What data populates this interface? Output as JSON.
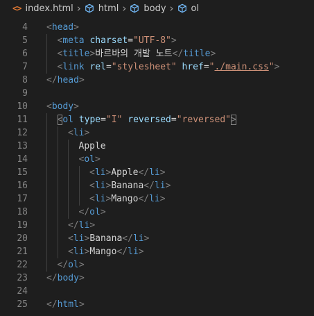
{
  "breadcrumb": {
    "file_icon": "<>",
    "file": "index.html",
    "items": [
      "html",
      "body",
      "ol"
    ]
  },
  "icons": {
    "file": "html-file-icon",
    "element": "cube-icon",
    "separator": "chevron-right-icon"
  },
  "colors": {
    "background": "#1e1e1e",
    "tag": "#569cd6",
    "bracket": "#808080",
    "attribute": "#9cdcfe",
    "string": "#ce9178",
    "text": "#d4d4d4",
    "line_number": "#858585",
    "file_icon": "#e37933"
  },
  "lines": [
    {
      "n": "4",
      "indent": 0,
      "tokens": [
        [
          "br",
          "<"
        ],
        [
          "tag",
          "head"
        ],
        [
          "br",
          ">"
        ]
      ]
    },
    {
      "n": "5",
      "indent": 1,
      "tokens": [
        [
          "br",
          "<"
        ],
        [
          "tag",
          "meta"
        ],
        [
          "pl",
          " "
        ],
        [
          "attr",
          "charset"
        ],
        [
          "pl",
          "="
        ],
        [
          "str",
          "\"UTF-8\""
        ],
        [
          "br",
          ">"
        ]
      ]
    },
    {
      "n": "6",
      "indent": 1,
      "tokens": [
        [
          "br",
          "<"
        ],
        [
          "tag",
          "title"
        ],
        [
          "br",
          ">"
        ],
        [
          "pl",
          "바르바의 개발 노트"
        ],
        [
          "br",
          "</"
        ],
        [
          "tag",
          "title"
        ],
        [
          "br",
          ">"
        ]
      ]
    },
    {
      "n": "7",
      "indent": 1,
      "tokens": [
        [
          "br",
          "<"
        ],
        [
          "tag",
          "link"
        ],
        [
          "pl",
          " "
        ],
        [
          "attr",
          "rel"
        ],
        [
          "pl",
          "="
        ],
        [
          "str",
          "\"stylesheet\""
        ],
        [
          "pl",
          " "
        ],
        [
          "attr",
          "href"
        ],
        [
          "pl",
          "="
        ],
        [
          "str",
          "\""
        ],
        [
          "str link",
          "./main.css"
        ],
        [
          "str",
          "\""
        ],
        [
          "br",
          ">"
        ]
      ]
    },
    {
      "n": "8",
      "indent": 0,
      "tokens": [
        [
          "br",
          "</"
        ],
        [
          "tag",
          "head"
        ],
        [
          "br",
          ">"
        ]
      ]
    },
    {
      "n": "9",
      "indent": 0,
      "tokens": []
    },
    {
      "n": "10",
      "indent": 0,
      "tokens": [
        [
          "br",
          "<"
        ],
        [
          "tag",
          "body"
        ],
        [
          "br",
          ">"
        ]
      ]
    },
    {
      "n": "11",
      "indent": 1,
      "tokens": [
        [
          "br hl-bracket",
          "<"
        ],
        [
          "tag",
          "ol"
        ],
        [
          "pl",
          " "
        ],
        [
          "attr",
          "type"
        ],
        [
          "pl",
          "="
        ],
        [
          "str",
          "\"I\""
        ],
        [
          "pl",
          " "
        ],
        [
          "attr",
          "reversed"
        ],
        [
          "pl",
          "="
        ],
        [
          "str",
          "\"reversed\""
        ],
        [
          "br hl-bracket",
          ">"
        ]
      ]
    },
    {
      "n": "12",
      "indent": 2,
      "tokens": [
        [
          "br",
          "<"
        ],
        [
          "tag",
          "li"
        ],
        [
          "br",
          ">"
        ]
      ]
    },
    {
      "n": "13",
      "indent": 3,
      "tokens": [
        [
          "pl",
          "Apple"
        ]
      ]
    },
    {
      "n": "14",
      "indent": 3,
      "tokens": [
        [
          "br",
          "<"
        ],
        [
          "tag",
          "ol"
        ],
        [
          "br",
          ">"
        ]
      ]
    },
    {
      "n": "15",
      "indent": 4,
      "tokens": [
        [
          "br",
          "<"
        ],
        [
          "tag",
          "li"
        ],
        [
          "br",
          ">"
        ],
        [
          "pl",
          "Apple"
        ],
        [
          "br",
          "</"
        ],
        [
          "tag",
          "li"
        ],
        [
          "br",
          ">"
        ]
      ]
    },
    {
      "n": "16",
      "indent": 4,
      "tokens": [
        [
          "br",
          "<"
        ],
        [
          "tag",
          "li"
        ],
        [
          "br",
          ">"
        ],
        [
          "pl",
          "Banana"
        ],
        [
          "br",
          "</"
        ],
        [
          "tag",
          "li"
        ],
        [
          "br",
          ">"
        ]
      ]
    },
    {
      "n": "17",
      "indent": 4,
      "tokens": [
        [
          "br",
          "<"
        ],
        [
          "tag",
          "li"
        ],
        [
          "br",
          ">"
        ],
        [
          "pl",
          "Mango"
        ],
        [
          "br",
          "</"
        ],
        [
          "tag",
          "li"
        ],
        [
          "br",
          ">"
        ]
      ]
    },
    {
      "n": "18",
      "indent": 3,
      "tokens": [
        [
          "br",
          "</"
        ],
        [
          "tag",
          "ol"
        ],
        [
          "br",
          ">"
        ]
      ]
    },
    {
      "n": "19",
      "indent": 2,
      "tokens": [
        [
          "br",
          "</"
        ],
        [
          "tag",
          "li"
        ],
        [
          "br",
          ">"
        ]
      ]
    },
    {
      "n": "20",
      "indent": 2,
      "tokens": [
        [
          "br",
          "<"
        ],
        [
          "tag",
          "li"
        ],
        [
          "br",
          ">"
        ],
        [
          "pl",
          "Banana"
        ],
        [
          "br",
          "</"
        ],
        [
          "tag",
          "li"
        ],
        [
          "br",
          ">"
        ]
      ]
    },
    {
      "n": "21",
      "indent": 2,
      "tokens": [
        [
          "br",
          "<"
        ],
        [
          "tag",
          "li"
        ],
        [
          "br",
          ">"
        ],
        [
          "pl",
          "Mango"
        ],
        [
          "br",
          "</"
        ],
        [
          "tag",
          "li"
        ],
        [
          "br",
          ">"
        ]
      ]
    },
    {
      "n": "22",
      "indent": 1,
      "tokens": [
        [
          "br",
          "</"
        ],
        [
          "tag",
          "ol"
        ],
        [
          "br",
          ">"
        ]
      ]
    },
    {
      "n": "23",
      "indent": 0,
      "tokens": [
        [
          "br",
          "</"
        ],
        [
          "tag",
          "body"
        ],
        [
          "br",
          ">"
        ]
      ]
    },
    {
      "n": "24",
      "indent": 0,
      "tokens": []
    },
    {
      "n": "25",
      "indent": 0,
      "tokens": [
        [
          "br",
          "</"
        ],
        [
          "tag",
          "html"
        ],
        [
          "br",
          ">"
        ]
      ]
    }
  ]
}
